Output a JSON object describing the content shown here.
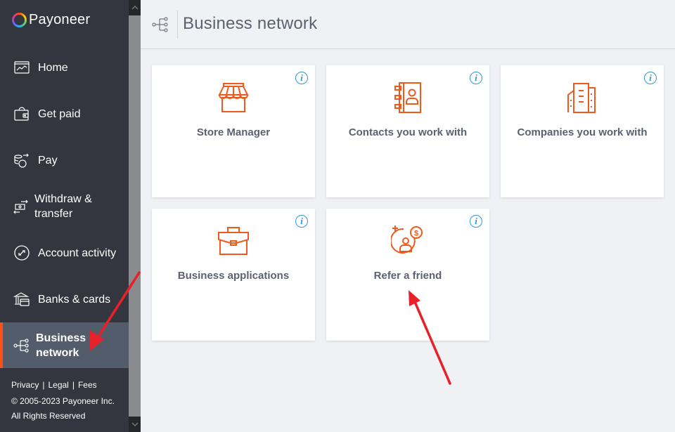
{
  "brand": {
    "name": "Payoneer",
    "accent": "#ff4f17"
  },
  "sidebar": {
    "items": [
      {
        "label": "Home",
        "icon": "home-chart-icon"
      },
      {
        "label": "Get paid",
        "icon": "wallet-icon"
      },
      {
        "label": "Pay",
        "icon": "coins-arrow-icon"
      },
      {
        "label": "Withdraw & transfer",
        "icon": "cash-transfer-icon"
      },
      {
        "label": "Account activity",
        "icon": "activity-icon"
      },
      {
        "label": "Banks & cards",
        "icon": "bank-card-icon"
      },
      {
        "label": "Business network",
        "icon": "network-icon",
        "active": true
      }
    ],
    "footer": {
      "links": [
        "Privacy",
        "Legal",
        "Fees"
      ],
      "separator": "|",
      "copyright": "© 2005-2023 Payoneer Inc. All Rights Reserved"
    }
  },
  "header": {
    "title": "Business network",
    "icon": "network-icon"
  },
  "cards": [
    {
      "title": "Store Manager",
      "icon": "storefront-icon",
      "info": "i"
    },
    {
      "title": "Contacts you work with",
      "icon": "address-book-icon",
      "info": "i"
    },
    {
      "title": "Companies you work with",
      "icon": "buildings-icon",
      "info": "i"
    },
    {
      "title": "Business applications",
      "icon": "briefcase-icon",
      "info": "i"
    },
    {
      "title": "Refer a friend",
      "icon": "refer-friend-icon",
      "info": "i"
    }
  ],
  "scrollbar": {
    "up": "^",
    "down": "v"
  },
  "colors": {
    "icon_orange": "#ee5a1c",
    "info_blue": "#2b9ad6",
    "annotation_red": "#e8202a"
  }
}
